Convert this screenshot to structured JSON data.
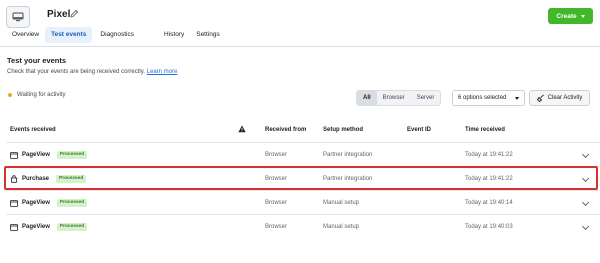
{
  "header": {
    "title": "Pixel",
    "pixel_icon": "monitor-icon",
    "edit_icon": "pencil-icon",
    "create_label": "Create"
  },
  "tabs": [
    {
      "label": "Overview",
      "active": false
    },
    {
      "label": "Test events",
      "active": true
    },
    {
      "label": "Diagnostics",
      "active": false
    },
    {
      "label": "History",
      "active": false
    },
    {
      "label": "Settings",
      "active": false
    }
  ],
  "section": {
    "title": "Test your events",
    "desc": "Check that your events are being received correctly.",
    "learn_more": "Learn more"
  },
  "status": {
    "text": "Waiting for activity",
    "dot_color": "#f5a623"
  },
  "filters": {
    "segments": [
      {
        "label": "All",
        "active": true
      },
      {
        "label": "Browser",
        "active": false
      },
      {
        "label": "Server",
        "active": false
      }
    ],
    "options_value": "6 options selected",
    "clear_label": "Clear Activity"
  },
  "table": {
    "headers": {
      "event": "Events received",
      "warn_icon": "warning-icon",
      "received_from": "Received from",
      "setup": "Setup method",
      "event_id": "Event ID",
      "time": "Time received"
    },
    "rows": [
      {
        "icon": "page-icon",
        "event": "PageView",
        "badge": "Processed",
        "from": "Browser",
        "setup": "Partner integration",
        "event_id": "",
        "time": "Today at 19:41:22",
        "highlighted": false
      },
      {
        "icon": "cart-icon",
        "event": "Purchase",
        "badge": "Processed",
        "from": "Browser",
        "setup": "Partner integration",
        "event_id": "",
        "time": "Today at 19:41:22",
        "highlighted": true
      },
      {
        "icon": "page-icon",
        "event": "PageView",
        "badge": "Processed",
        "from": "Browser",
        "setup": "Manual setup",
        "event_id": "",
        "time": "Today at 19:40:14",
        "highlighted": false
      },
      {
        "icon": "page-icon",
        "event": "PageView",
        "badge": "Processed",
        "from": "Browser",
        "setup": "Manual setup",
        "event_id": "",
        "time": "Today at 19:40:03",
        "highlighted": false
      }
    ]
  },
  "colors": {
    "create_button": "#42b72a",
    "active_tab_bg": "#e7f0fd",
    "badge_bg": "#d6f0cd",
    "highlight_border": "#d93030",
    "link": "#216fdb"
  }
}
